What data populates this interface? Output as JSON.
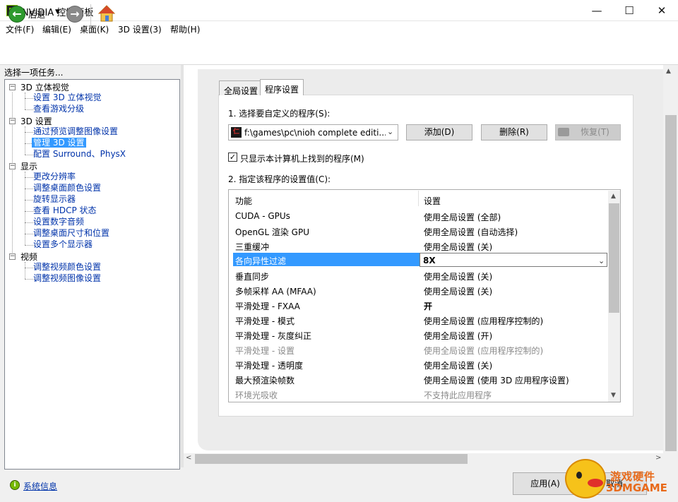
{
  "window": {
    "title": "NVIDIA 控制面板",
    "min_glyph": "—",
    "max_glyph": "☐",
    "close_glyph": "✕"
  },
  "menu": [
    "文件(F)",
    "编辑(E)",
    "桌面(K)",
    "3D 设置(3)",
    "帮助(H)"
  ],
  "toolbar": {
    "back_label": "后退"
  },
  "left_panel": {
    "task_label": "选择一项任务...",
    "tree": [
      {
        "label": "3D 立体视觉",
        "children": [
          "设置 3D 立体视觉",
          "查看游戏分级"
        ]
      },
      {
        "label": "3D 设置",
        "children": [
          "通过预览调整图像设置",
          "管理 3D 设置",
          "配置 Surround、PhysX"
        ]
      },
      {
        "label": "显示",
        "children": [
          "更改分辨率",
          "调整桌面颜色设置",
          "旋转显示器",
          "查看 HDCP 状态",
          "设置数字音频",
          "调整桌面尺寸和位置",
          "设置多个显示器"
        ]
      },
      {
        "label": "视频",
        "children": [
          "调整视频颜色设置",
          "调整视频图像设置"
        ]
      }
    ],
    "selected_item": "管理 3D 设置",
    "sysinfo_link": "系统信息"
  },
  "tabs": {
    "global": "全局设置",
    "program": "程序设置",
    "active": "program"
  },
  "program_section": {
    "step1_label": "1. 选择要自定义的程序(S):",
    "selected_program": "f:\\games\\pc\\nioh complete editi...",
    "program_icon_text": "仁",
    "add_label": "添加(D)",
    "delete_label": "删除(R)",
    "restore_label": "恢复(T)",
    "only_show_label": "只显示本计算机上找到的程序(M)",
    "only_show_checked": true,
    "step2_label": "2. 指定该程序的设置值(C):"
  },
  "settings_table": {
    "col_feature": "功能",
    "col_setting": "设置",
    "rows": [
      {
        "feature": "CUDA - GPUs",
        "setting": "使用全局设置 (全部)"
      },
      {
        "feature": "OpenGL 渲染 GPU",
        "setting": "使用全局设置 (自动选择)"
      },
      {
        "feature": "三重缓冲",
        "setting": "使用全局设置 (关)"
      },
      {
        "feature": "各向异性过滤",
        "setting": "8X",
        "selected": true
      },
      {
        "feature": "垂直同步",
        "setting": "使用全局设置 (关)"
      },
      {
        "feature": "多帧采样 AA (MFAA)",
        "setting": "使用全局设置 (关)"
      },
      {
        "feature": "平滑处理 - FXAA",
        "setting": "开",
        "bold": true
      },
      {
        "feature": "平滑处理 - 模式",
        "setting": "使用全局设置 (应用程序控制的)"
      },
      {
        "feature": "平滑处理 - 灰度纠正",
        "setting": "使用全局设置 (开)"
      },
      {
        "feature": "平滑处理 - 设置",
        "setting": "使用全局设置 (应用程序控制的)",
        "disabled": true
      },
      {
        "feature": "平滑处理 - 透明度",
        "setting": "使用全局设置 (关)"
      },
      {
        "feature": "最大预渲染帧数",
        "setting": "使用全局设置 (使用 3D 应用程序设置)"
      },
      {
        "feature": "环境光吸收",
        "setting": "不支持此应用程序",
        "disabled": true
      }
    ]
  },
  "bottom": {
    "apply_label": "应用(A)",
    "cancel_label": "取消"
  },
  "watermark": {
    "cn": "游戏硬件",
    "en": "3DMGAME"
  },
  "colors": {
    "nvidia_green": "#76b900",
    "selection_blue": "#3399ff",
    "link_blue": "#0033aa"
  }
}
